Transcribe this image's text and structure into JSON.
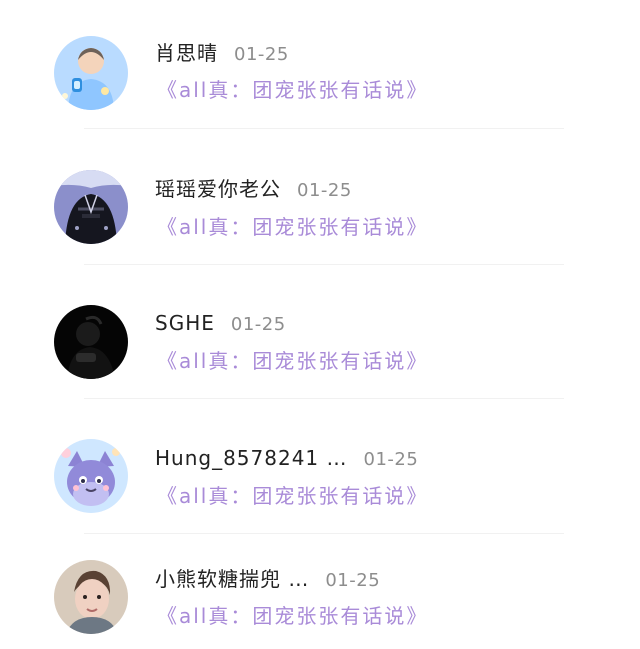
{
  "messages": [
    {
      "name": "肖思晴",
      "date": "01-25",
      "preview": "《all真：团宠张张有话说》",
      "avatar_icon": "person-avatar-icon"
    },
    {
      "name": "瑶瑶爱你老公",
      "date": "01-25",
      "preview": "《all真：团宠张张有话说》",
      "avatar_icon": "dark-outfit-avatar-icon"
    },
    {
      "name": "SGHE",
      "date": "01-25",
      "preview": "《all真：团宠张张有话说》",
      "avatar_icon": "dark-avatar-icon"
    },
    {
      "name": "Hung_8578241 …",
      "date": "01-25",
      "preview": "《all真：团宠张张有话说》",
      "avatar_icon": "cartoon-cat-avatar-icon"
    },
    {
      "name": "小熊软糖揣兜 …",
      "date": "01-25",
      "preview": "《all真：团宠张张有话说》",
      "avatar_icon": "portrait-avatar-icon"
    }
  ],
  "colors": {
    "preview_text": "#a98bd8",
    "date_text": "#8d8d8d",
    "name_text": "#222222"
  }
}
